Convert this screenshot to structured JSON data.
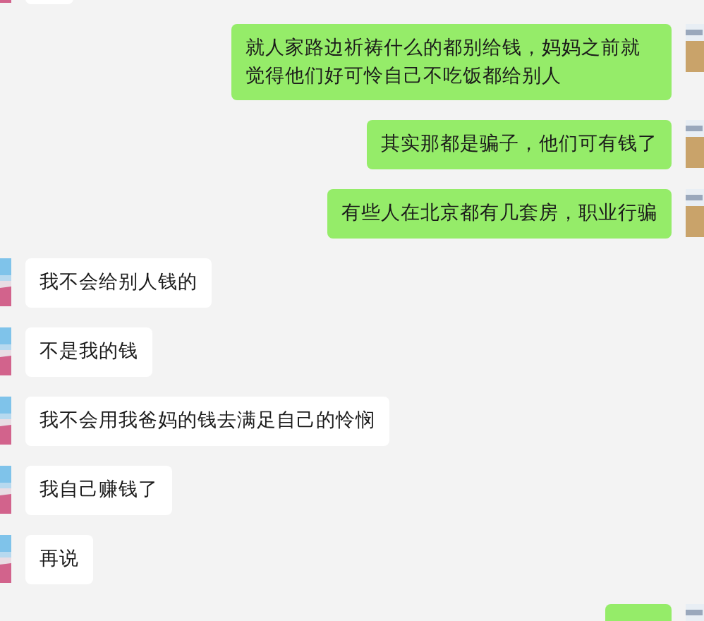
{
  "messages": [
    {
      "kind": "received"
    },
    {
      "kind": "sent",
      "text": "就人家路边祈祷什么的都别给钱，妈妈之前就觉得他们好可怜自己不吃饭都给别人"
    },
    {
      "kind": "sent",
      "text": "其实那都是骗子，他们可有钱了"
    },
    {
      "kind": "sent",
      "text": "有些人在北京都有几套房，职业行骗"
    },
    {
      "kind": "received",
      "text": "我不会给别人钱的"
    },
    {
      "kind": "received",
      "text": "不是我的钱"
    },
    {
      "kind": "received",
      "text": "我不会用我爸妈的钱去满足自己的怜悯"
    },
    {
      "kind": "received",
      "text": "我自己赚钱了"
    },
    {
      "kind": "received",
      "text": "再说"
    },
    {
      "kind": "sent"
    }
  ]
}
